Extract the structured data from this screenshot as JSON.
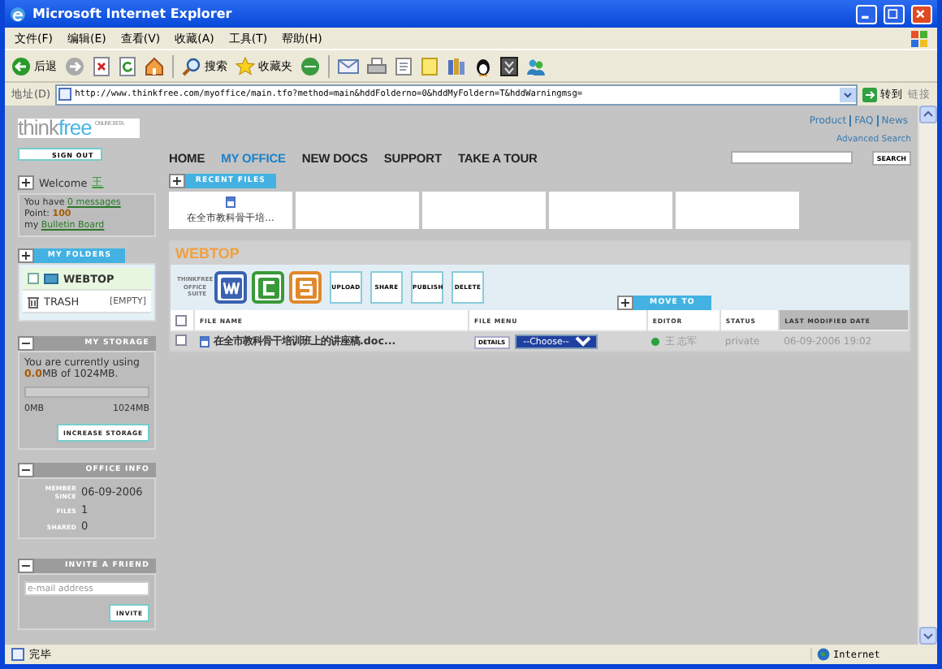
{
  "window": {
    "title": "Microsoft Internet Explorer"
  },
  "menu": [
    "文件(F)",
    "编辑(E)",
    "查看(V)",
    "收藏(A)",
    "工具(T)",
    "帮助(H)"
  ],
  "toolbar": {
    "back": "后退",
    "search": "搜索",
    "favorites": "收藏夹"
  },
  "address": {
    "label": "地址(D)",
    "value": "http://www.thinkfree.com/myoffice/main.tfo?method=main&hddFolderno=0&hddMyFoldern=T&hddWarningmsg=",
    "go": "转到",
    "links": "链接"
  },
  "site": {
    "logo": "think",
    "logo_accent": "free",
    "logo_tag": "ONLINE BETA",
    "sign_out": "SIGN OUT",
    "top_links": [
      "Product",
      "FAQ",
      "News"
    ],
    "advanced_search": "Advanced Search",
    "nav": [
      {
        "label": "HOME",
        "selected": false
      },
      {
        "label": "MY OFFICE",
        "selected": true
      },
      {
        "label": "NEW DOCS",
        "selected": false
      },
      {
        "label": "SUPPORT",
        "selected": false
      },
      {
        "label": "TAKE A TOUR",
        "selected": false
      }
    ],
    "search_button": "SEARCH"
  },
  "welcome": {
    "toggle": "+",
    "title": "Welcome",
    "user": "王",
    "prefix": "You have",
    "messages": "0 messages",
    "point_label": "Point:",
    "point": "100",
    "board_prefix": "my",
    "board": "Bulletin Board"
  },
  "folders": {
    "toggle": "+",
    "title": "MY FOLDERS",
    "items": [
      {
        "kind": "folder",
        "name": "WEBTOP",
        "selected": true,
        "checked": false
      },
      {
        "kind": "trash",
        "name": "TRASH",
        "note": "[EMPTY]",
        "selected": false
      }
    ]
  },
  "storage": {
    "toggle": "−",
    "title": "MY STORAGE",
    "before": "You are currently using",
    "used": "0.0",
    "after": "MB of 1024MB.",
    "level": 0,
    "min": "0MB",
    "max": "1024MB",
    "button": "INCREASE STORAGE"
  },
  "office_info": {
    "toggle": "−",
    "title": "OFFICE INFO",
    "rows": [
      {
        "label": "MEMBER SINCE",
        "value": "06-09-2006"
      },
      {
        "label": "FILES",
        "value": "1"
      },
      {
        "label": "SHARED",
        "value": "0"
      }
    ]
  },
  "invite": {
    "toggle": "−",
    "title": "INVITE A FRIEND",
    "placeholder": "e-mail address",
    "button": "INVITE"
  },
  "recent": {
    "toggle": "+",
    "title": "RECENT FILES",
    "cards": [
      {
        "kind": "file",
        "name": "在全市教科骨干培..."
      },
      {
        "kind": "empty"
      },
      {
        "kind": "empty"
      },
      {
        "kind": "empty"
      },
      {
        "kind": "empty"
      }
    ]
  },
  "webtop": {
    "title": "WEBTOP",
    "suite": "THINKFREE OFFICE SUITE",
    "apps": [
      {
        "kind": "write",
        "color": "#3a62b0"
      },
      {
        "kind": "calc",
        "color": "#3a9a3a"
      },
      {
        "kind": "show",
        "color": "#e0882a"
      }
    ],
    "actions": [
      "UPLOAD",
      "SHARE",
      "PUBLISH",
      "DELETE"
    ],
    "move": {
      "toggle": "+",
      "label": "MOVE TO"
    },
    "select_all": false,
    "columns": [
      "FILE NAME",
      "FILE MENU",
      "EDITOR",
      "STATUS",
      "LAST MODIFIED DATE"
    ],
    "rows": [
      {
        "checked": false,
        "name": "在全市教科骨干培训班上的讲座稿.doc...",
        "details": "DETAILS",
        "choose": "--Choose--",
        "online": true,
        "editor": "王 志军",
        "status": "private",
        "date": "06-09-2006 19:02"
      }
    ]
  },
  "status_bar": {
    "text": "完毕",
    "zone": "Internet"
  }
}
